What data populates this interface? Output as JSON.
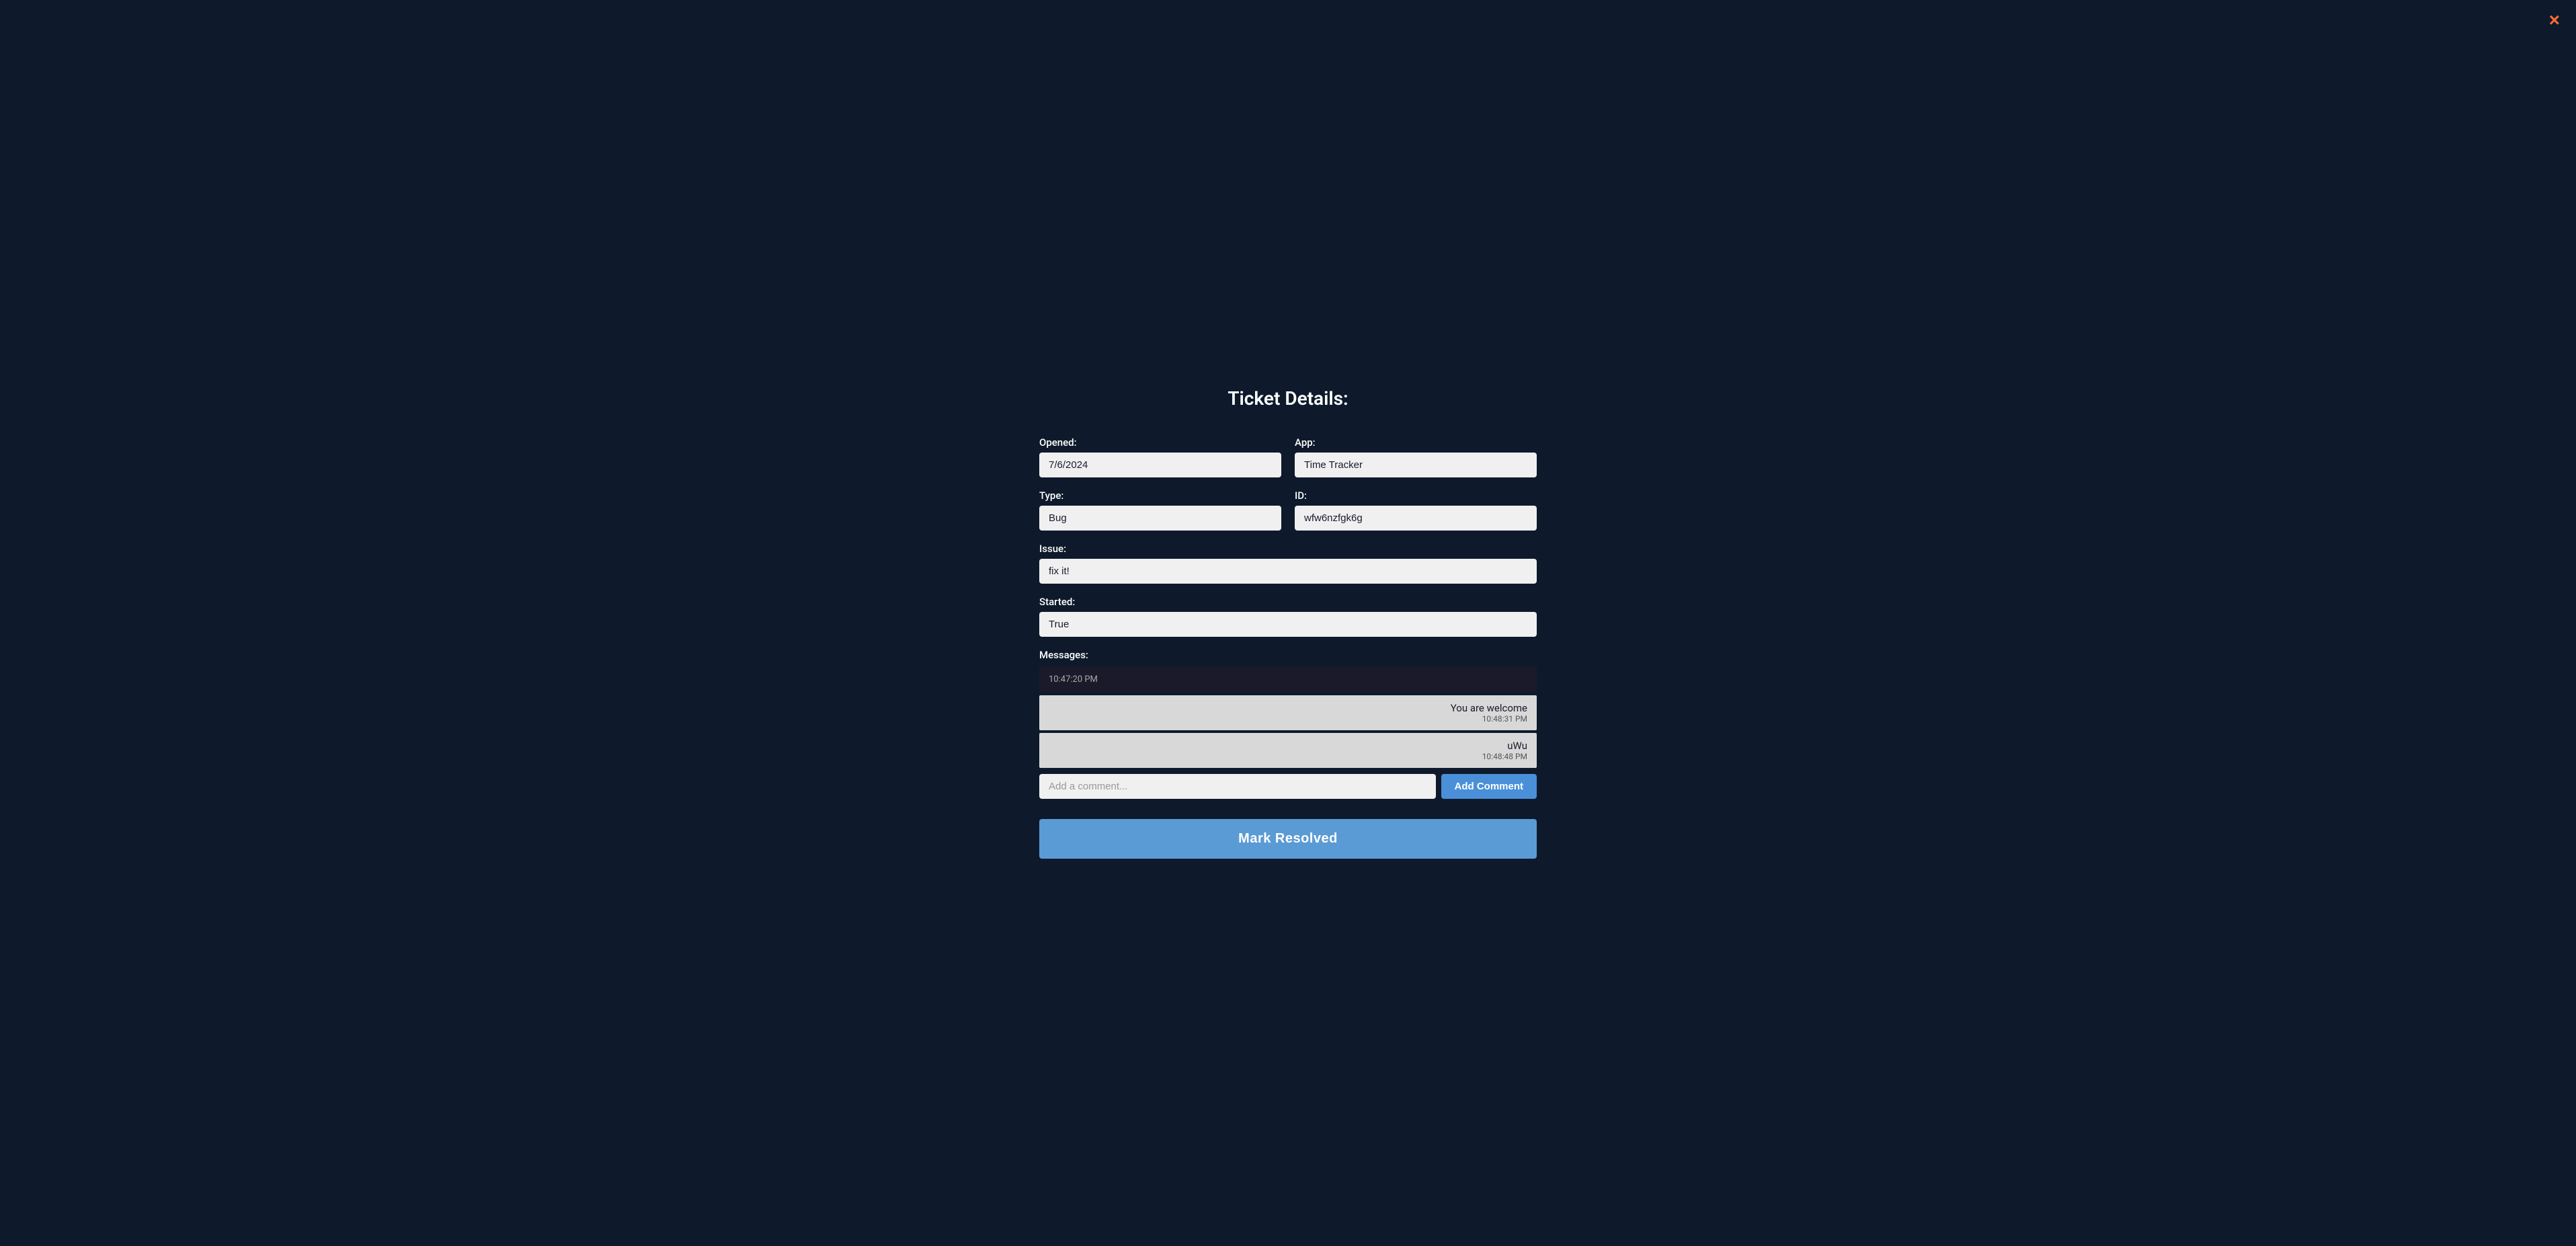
{
  "modal": {
    "title": "Ticket Details:",
    "close_label": "×"
  },
  "fields": {
    "opened_label": "Opened:",
    "opened_value": "7/6/2024",
    "app_label": "App:",
    "app_value": "Time Tracker",
    "type_label": "Type:",
    "type_value": "Bug",
    "id_label": "ID:",
    "id_value": "wfw6nzfgk6g",
    "issue_label": "Issue:",
    "issue_value": "fix it!",
    "started_label": "Started:",
    "started_value": "True"
  },
  "messages": {
    "label": "Messages:",
    "items": [
      {
        "text": "",
        "time": "10:47:20 PM",
        "side": "left"
      },
      {
        "text": "You are welcome",
        "time": "10:48:31 PM",
        "side": "right"
      },
      {
        "text": "uWu",
        "time": "10:48:48 PM",
        "side": "right"
      }
    ]
  },
  "comment": {
    "placeholder": "Add a comment...",
    "button_label": "Add Comment"
  },
  "resolve_button_label": "Mark Resolved",
  "colors": {
    "bg": "#0e1a2b",
    "close_btn": "#ff6b35",
    "input_bg": "#f0f0f0",
    "accent_btn": "#4a90d9",
    "resolve_btn": "#5b9bd5"
  }
}
